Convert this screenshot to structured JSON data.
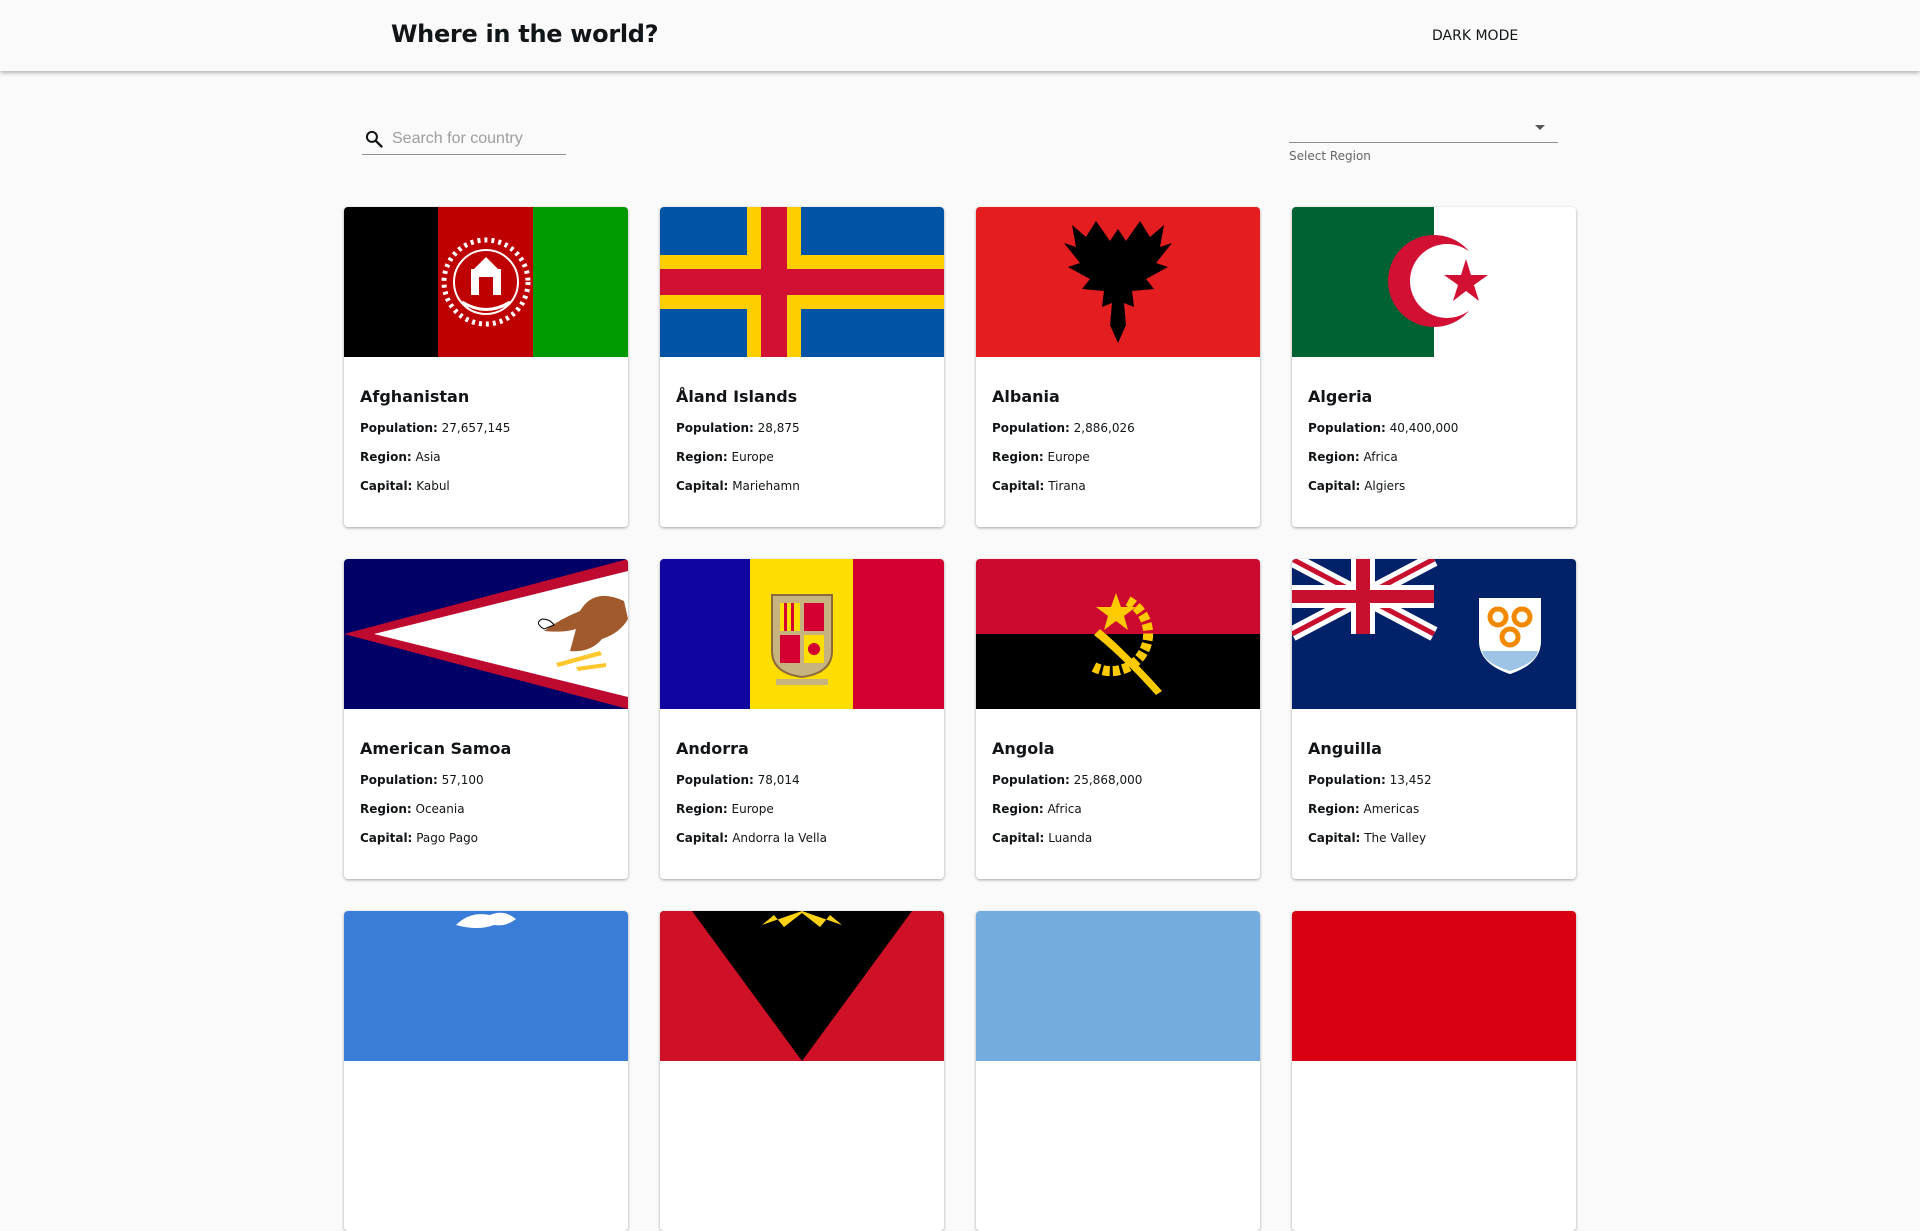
{
  "header": {
    "title": "Where in the world?",
    "mode_label": "DARK MODE"
  },
  "search": {
    "placeholder": "Search for country",
    "value": ""
  },
  "region": {
    "value": "",
    "helper": "Select Region"
  },
  "labels": {
    "population": "Population:",
    "region": "Region:",
    "capital": "Capital:"
  },
  "countries": [
    {
      "name": "Afghanistan",
      "population": "27,657,145",
      "region": "Asia",
      "capital": "Kabul",
      "flag": "afghanistan-flag"
    },
    {
      "name": "Åland Islands",
      "population": "28,875",
      "region": "Europe",
      "capital": "Mariehamn",
      "flag": "aland-flag"
    },
    {
      "name": "Albania",
      "population": "2,886,026",
      "region": "Europe",
      "capital": "Tirana",
      "flag": "albania-flag"
    },
    {
      "name": "Algeria",
      "population": "40,400,000",
      "region": "Africa",
      "capital": "Algiers",
      "flag": "algeria-flag"
    },
    {
      "name": "American Samoa",
      "population": "57,100",
      "region": "Oceania",
      "capital": "Pago Pago",
      "flag": "american-samoa-flag"
    },
    {
      "name": "Andorra",
      "population": "78,014",
      "region": "Europe",
      "capital": "Andorra la Vella",
      "flag": "andorra-flag"
    },
    {
      "name": "Angola",
      "population": "25,868,000",
      "region": "Africa",
      "capital": "Luanda",
      "flag": "angola-flag"
    },
    {
      "name": "Anguilla",
      "population": "13,452",
      "region": "Americas",
      "capital": "The Valley",
      "flag": "anguilla-flag"
    }
  ],
  "colors": {
    "background": "#fafafa",
    "card": "#ffffff",
    "text": "#111517"
  }
}
